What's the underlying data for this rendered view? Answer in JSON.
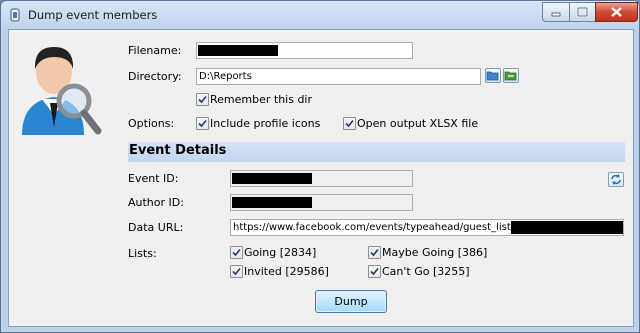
{
  "window": {
    "title": "Dump event members"
  },
  "form": {
    "filename_label": "Filename:",
    "directory_label": "Directory:",
    "directory_value": "D:\\Reports",
    "remember_dir_label": "Remember this dir",
    "options_label": "Options:",
    "include_icons_label": "Include profile icons",
    "open_xlsx_label": "Open output XLSX file",
    "event_details_heading": "Event Details",
    "event_id_label": "Event ID:",
    "author_id_label": "Author ID:",
    "data_url_label": "Data URL:",
    "data_url_value": "https://www.facebook.com/events/typeahead/guest_list/?event_id=",
    "lists_label": "Lists:",
    "list_going": "Going [2834]",
    "list_maybe": "Maybe Going [386]",
    "list_invited": "Invited [29586]",
    "list_cantgo": "Can't Go [3255]",
    "dump_button": "Dump"
  },
  "checkbox_states": {
    "remember_dir": true,
    "include_icons": true,
    "open_xlsx": true,
    "going": true,
    "maybe": true,
    "invited": true,
    "cantgo": true
  },
  "icons": [
    "app-icon",
    "user-magnifier-icon",
    "folder-icon",
    "folder-open-icon",
    "refresh-icon",
    "minimize-icon",
    "maximize-icon",
    "close-icon"
  ],
  "colors": {
    "section_bg": "#c7d9f3",
    "dump_button": "#bee6fd",
    "close_button": "#c13318"
  }
}
